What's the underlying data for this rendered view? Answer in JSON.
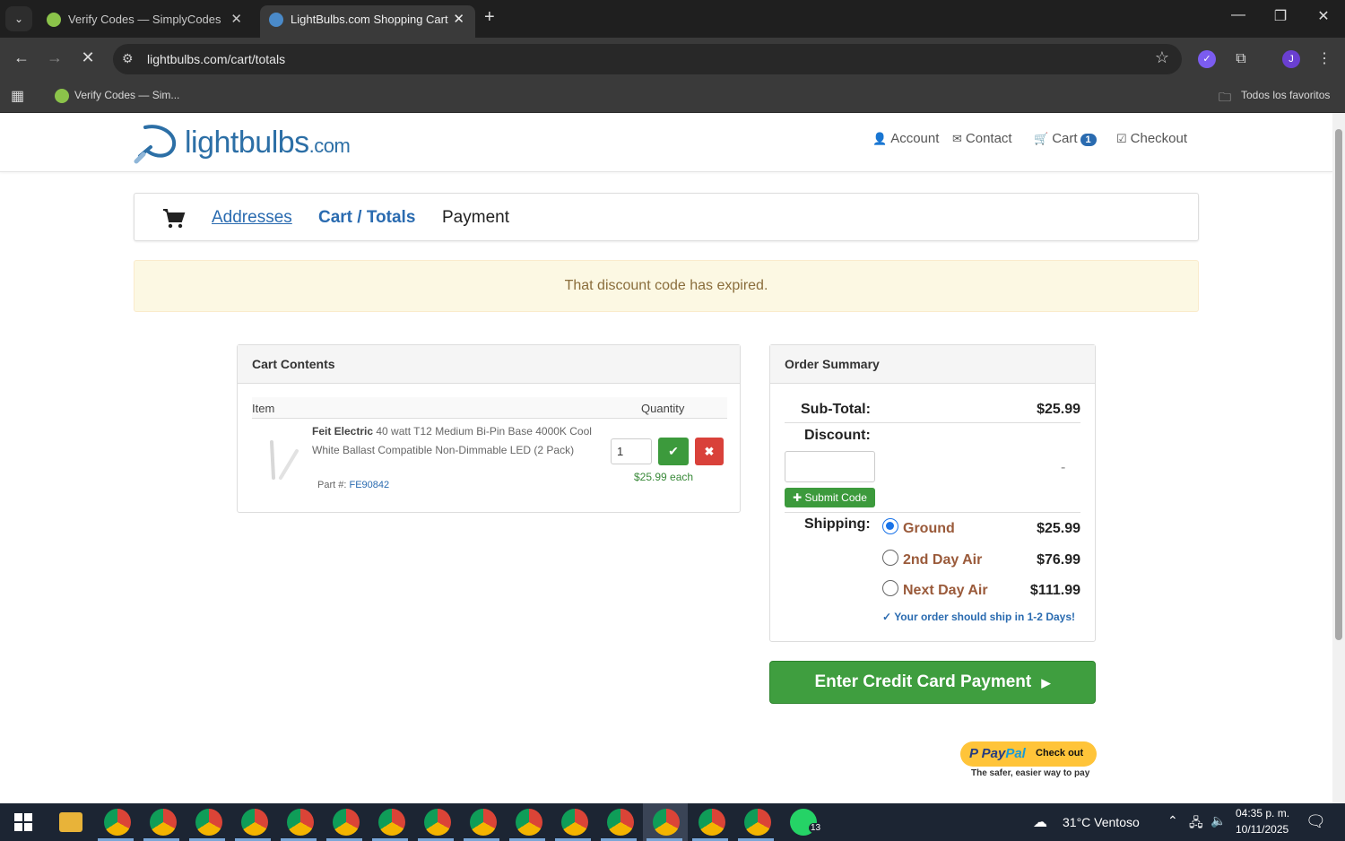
{
  "browser": {
    "tabs": [
      {
        "title": "Verify Codes — SimplyCodes",
        "active": false
      },
      {
        "title": "LightBulbs.com Shopping Cart",
        "active": true
      }
    ],
    "url": "lightbulbs.com/cart/totals",
    "bookmarks": {
      "item": "Verify Codes — Sim...",
      "folder": "Todos los favoritos"
    },
    "profile_initial": "J"
  },
  "header": {
    "logo_main": "lightbulbs",
    "logo_tld": ".com",
    "nav": {
      "account": "Account",
      "contact": "Contact",
      "cart": "Cart",
      "cart_count": "1",
      "checkout": "Checkout"
    }
  },
  "steps": {
    "addresses": "Addresses",
    "cart_totals": "Cart / Totals",
    "payment": "Payment"
  },
  "alert": "That discount code has expired.",
  "cart": {
    "heading": "Cart Contents",
    "col_item": "Item",
    "col_qty": "Quantity",
    "item": {
      "brand": "Feit Electric",
      "description": "40 watt T12 Medium Bi-Pin Base 4000K Cool White Ballast Compatible Non-Dimmable LED (2 Pack)",
      "part_label": "Part #:",
      "part_no": "FE90842",
      "qty": "1",
      "each_price": "$25.99 each"
    }
  },
  "summary": {
    "heading": "Order Summary",
    "subtotal_label": "Sub-Total:",
    "subtotal": "$25.99",
    "discount_label": "Discount:",
    "discount_value": "-",
    "submit_code": "Submit Code",
    "shipping_label": "Shipping:",
    "options": [
      {
        "name": "Ground",
        "price": "$25.99",
        "selected": true
      },
      {
        "name": "2nd Day Air",
        "price": "$76.99",
        "selected": false
      },
      {
        "name": "Next Day Air",
        "price": "$111.99",
        "selected": false
      }
    ],
    "ship_note": "Your order should ship in 1-2 Days!"
  },
  "cta": {
    "credit_card": "Enter Credit Card Payment"
  },
  "paypal": {
    "brand_pay": "Pay",
    "brand_pal": "Pal",
    "checkout": "Check out",
    "tagline": "The safer, easier way to pay"
  },
  "taskbar": {
    "weather": "31°C  Ventoso",
    "time": "04:35 p. m.",
    "date": "10/11/2025",
    "whatsapp_badge": "13"
  }
}
